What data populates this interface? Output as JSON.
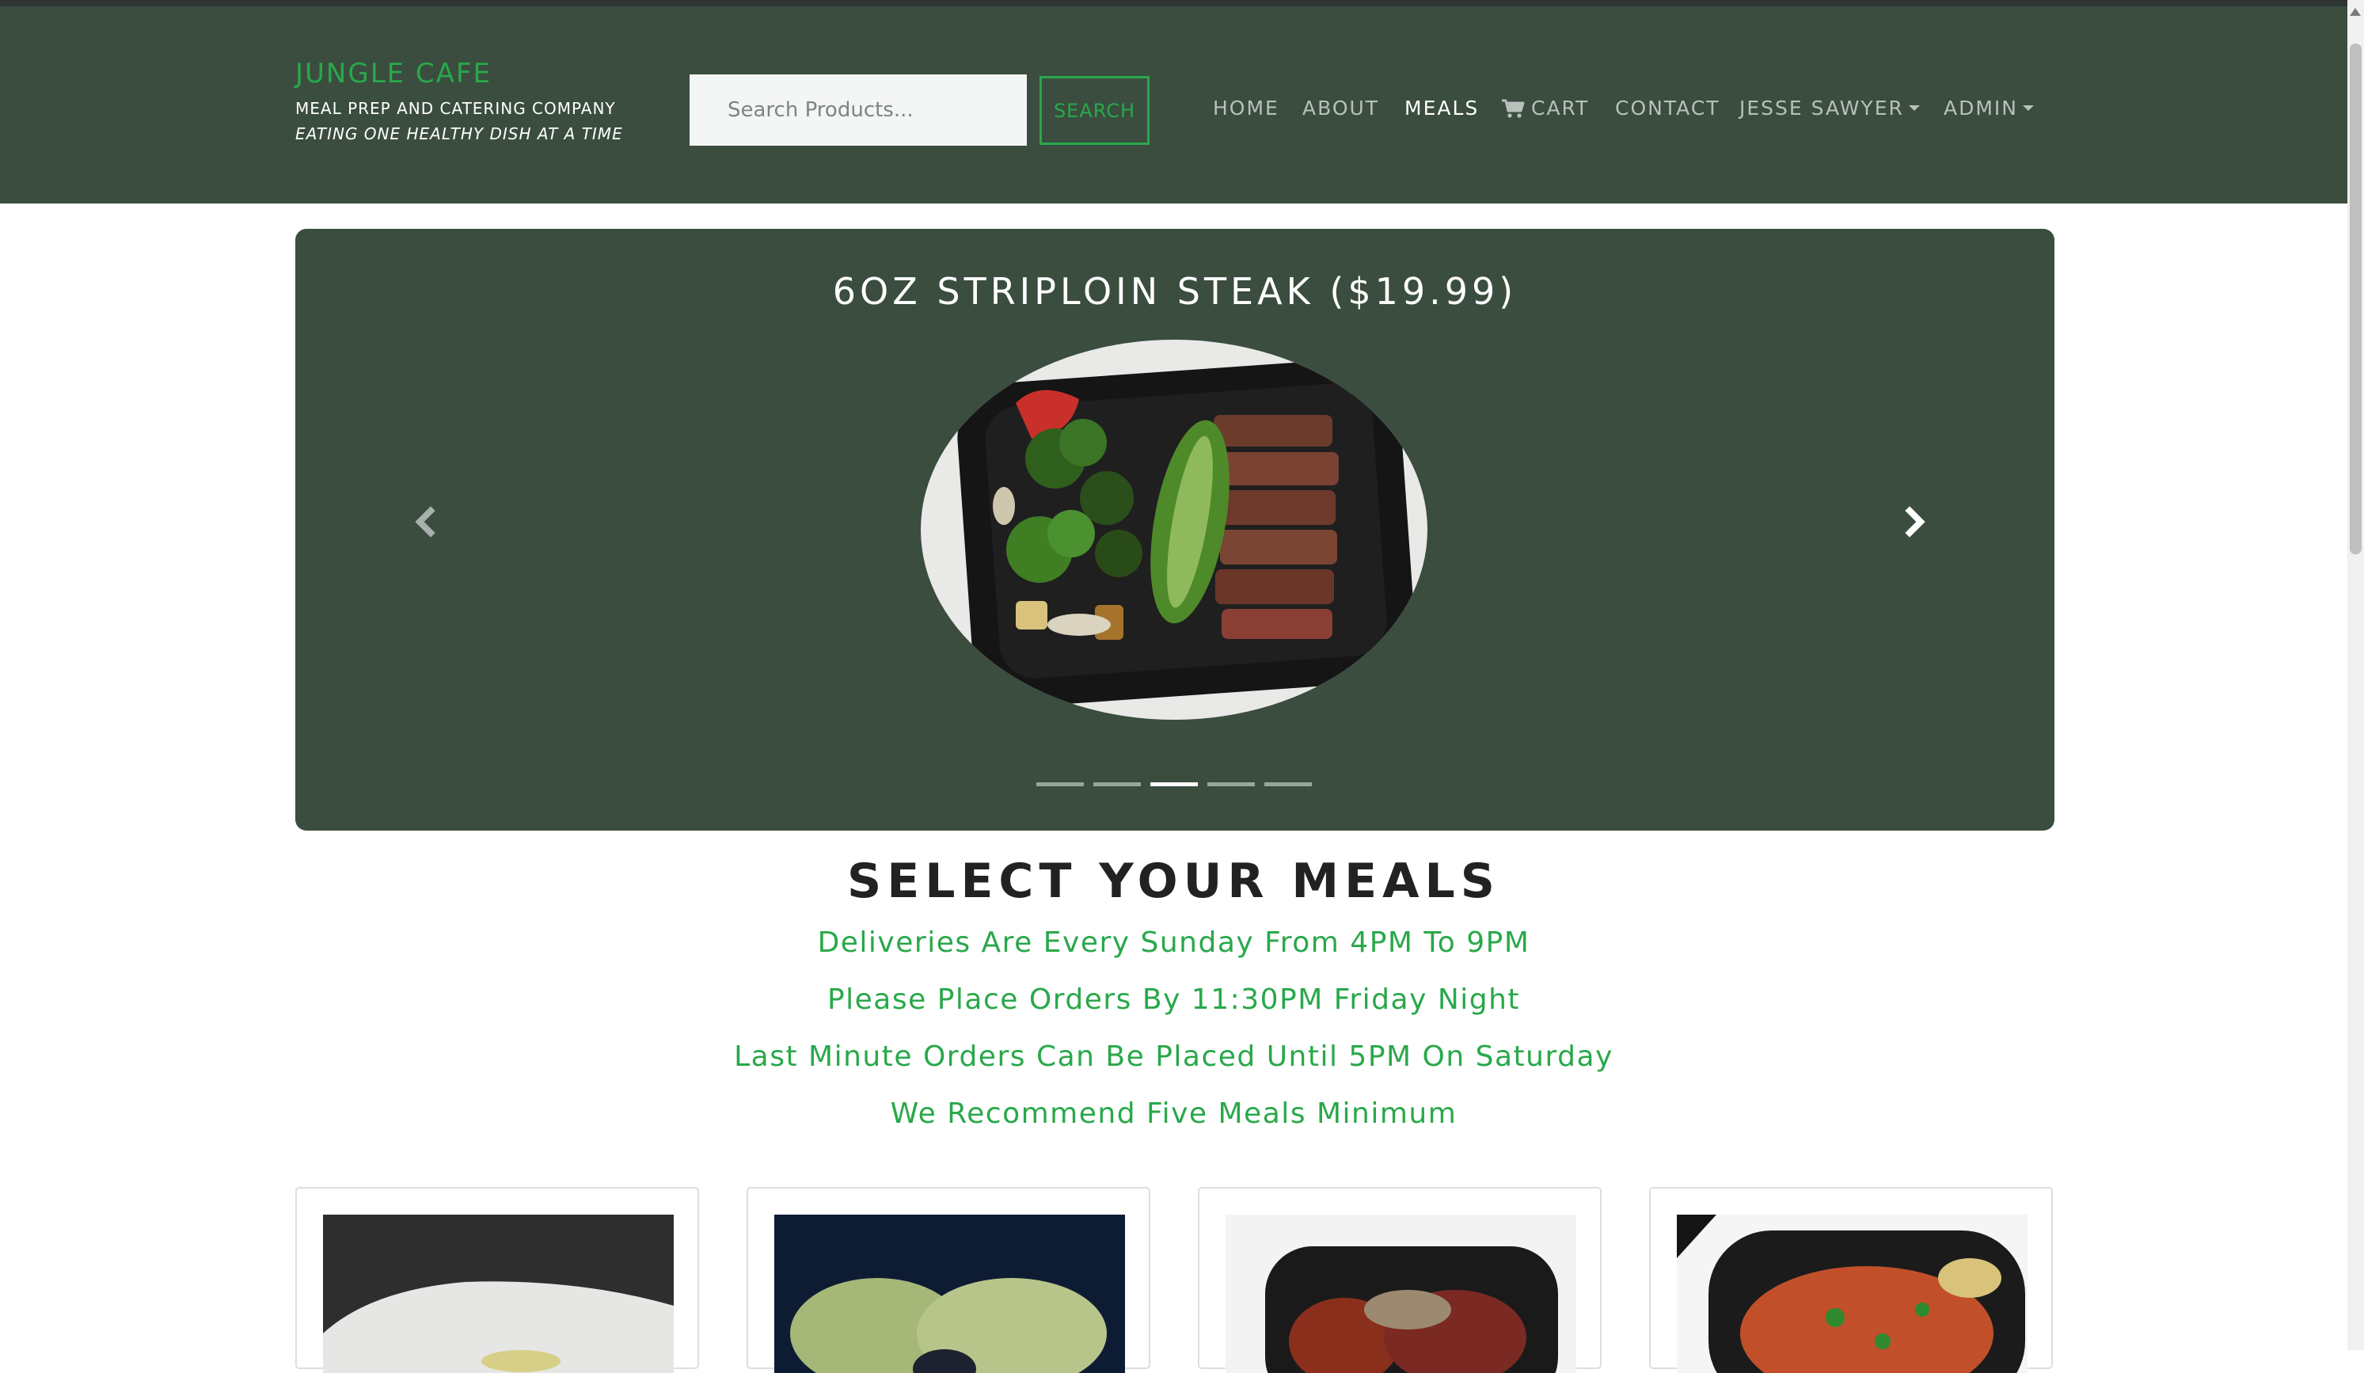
{
  "brand": {
    "title": "JUNGLE CAFE",
    "subtitle": "MEAL PREP AND CATERING COMPANY",
    "tagline": "EATING ONE HEALTHY DISH AT A TIME"
  },
  "search": {
    "placeholder": "Search Products...",
    "button_label": "SEARCH"
  },
  "nav": {
    "home": "HOME",
    "about": "ABOUT",
    "meals": "MEALS",
    "cart": "CART",
    "contact": "CONTACT",
    "user": "JESSE SAWYER",
    "admin": "ADMIN",
    "active": "meals"
  },
  "carousel": {
    "title": "6OZ STRIPLOIN STEAK ($19.99)",
    "slide_count": 5,
    "active_index": 2
  },
  "meals_section": {
    "title": "SELECT YOUR MEALS",
    "lines": [
      "Deliveries Are Every Sunday From 4PM To 9PM",
      "Please Place Orders By 11:30PM Friday Night",
      "Last Minute Orders Can Be Placed Until 5PM On Saturday",
      "We Recommend Five Meals Minimum"
    ]
  },
  "colors": {
    "header_bg": "#3a4d3f",
    "accent_green": "#29a84a",
    "nav_inactive": "#b8c0bb",
    "nav_active": "#ffffff"
  },
  "icons": {
    "cart": "cart-icon",
    "prev": "chevron-left-icon",
    "next": "chevron-right-icon"
  }
}
